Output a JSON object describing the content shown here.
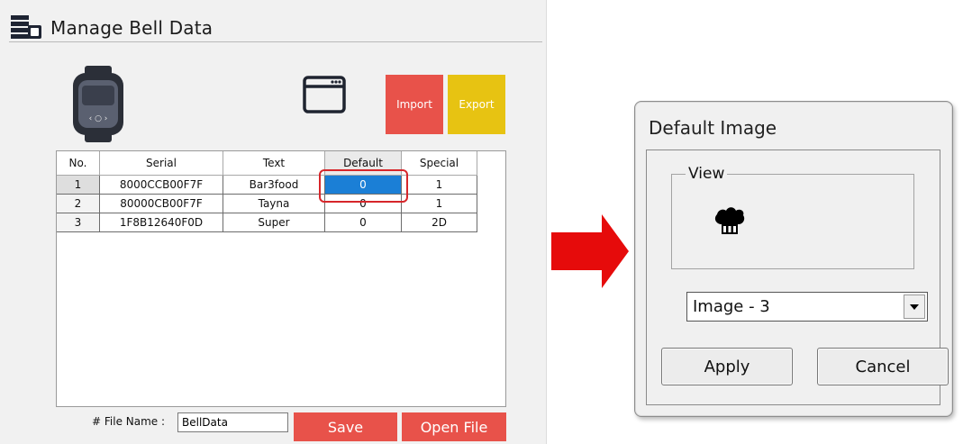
{
  "left_panel": {
    "title": "Manage Bell Data",
    "import_label": "Import",
    "export_label": "Export",
    "table": {
      "headers": [
        "No.",
        "Serial",
        "Text",
        "Default",
        "Special"
      ],
      "rows": [
        {
          "no": "1",
          "serial": "8000CCB00F7F",
          "text": "Bar3food",
          "default": "0",
          "special": "1"
        },
        {
          "no": "2",
          "serial": "80000CB00F7F",
          "text": "Tayna",
          "default": "0",
          "special": "1"
        },
        {
          "no": "3",
          "serial": "1F8B12640F0D",
          "text": "Super",
          "default": "0",
          "special": "2D"
        }
      ]
    },
    "file_name_label": "# File Name :",
    "file_name_value": "BellData",
    "save_label": "Save",
    "open_file_label": "Open File"
  },
  "dialog": {
    "title": "Default Image",
    "view_label": "View",
    "image_select_value": "Image - 3",
    "apply_label": "Apply",
    "cancel_label": "Cancel"
  },
  "colors": {
    "red_button": "#e8524a",
    "yellow_button": "#e7c312",
    "selection_blue": "#1b7fd6",
    "arrow_red": "#e60b0b",
    "highlight_red": "#d6262a"
  },
  "icons": [
    "database-icon",
    "smartwatch-icon",
    "window-icon",
    "arrow-right-icon",
    "chef-hat-icon",
    "dropdown-arrow-icon"
  ]
}
